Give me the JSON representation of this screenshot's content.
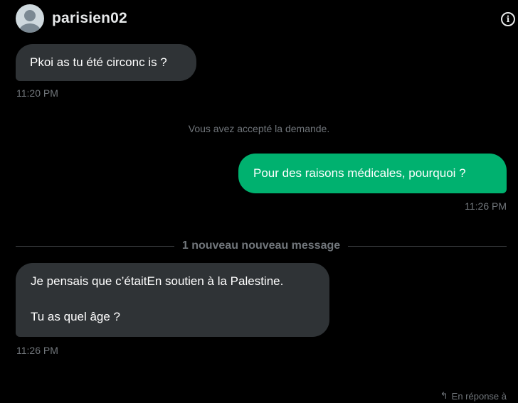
{
  "header": {
    "username": "parisien02",
    "info_icon": "i"
  },
  "messages": [
    {
      "text": "Pkoi as tu été circonc is ?",
      "time": "11:20 PM",
      "direction": "incoming"
    },
    {
      "text": "Pour des raisons médicales, pourquoi ?",
      "time": "11:26 PM",
      "direction": "outgoing"
    },
    {
      "lines": [
        "Je pensais que c’étaitEn soutien à la Palestine.",
        "Tu as quel âge ?"
      ],
      "time": "11:26 PM",
      "direction": "incoming"
    }
  ],
  "system_notice": "Vous avez accepté la demande.",
  "divider_label": "1 nouveau nouveau message",
  "reply_hint": {
    "icon": "reply-icon",
    "label": "En réponse à"
  },
  "colors": {
    "background": "#000000",
    "incoming_bubble": "#2f3336",
    "outgoing_bubble": "#00b16f",
    "muted_text": "#71767b"
  }
}
